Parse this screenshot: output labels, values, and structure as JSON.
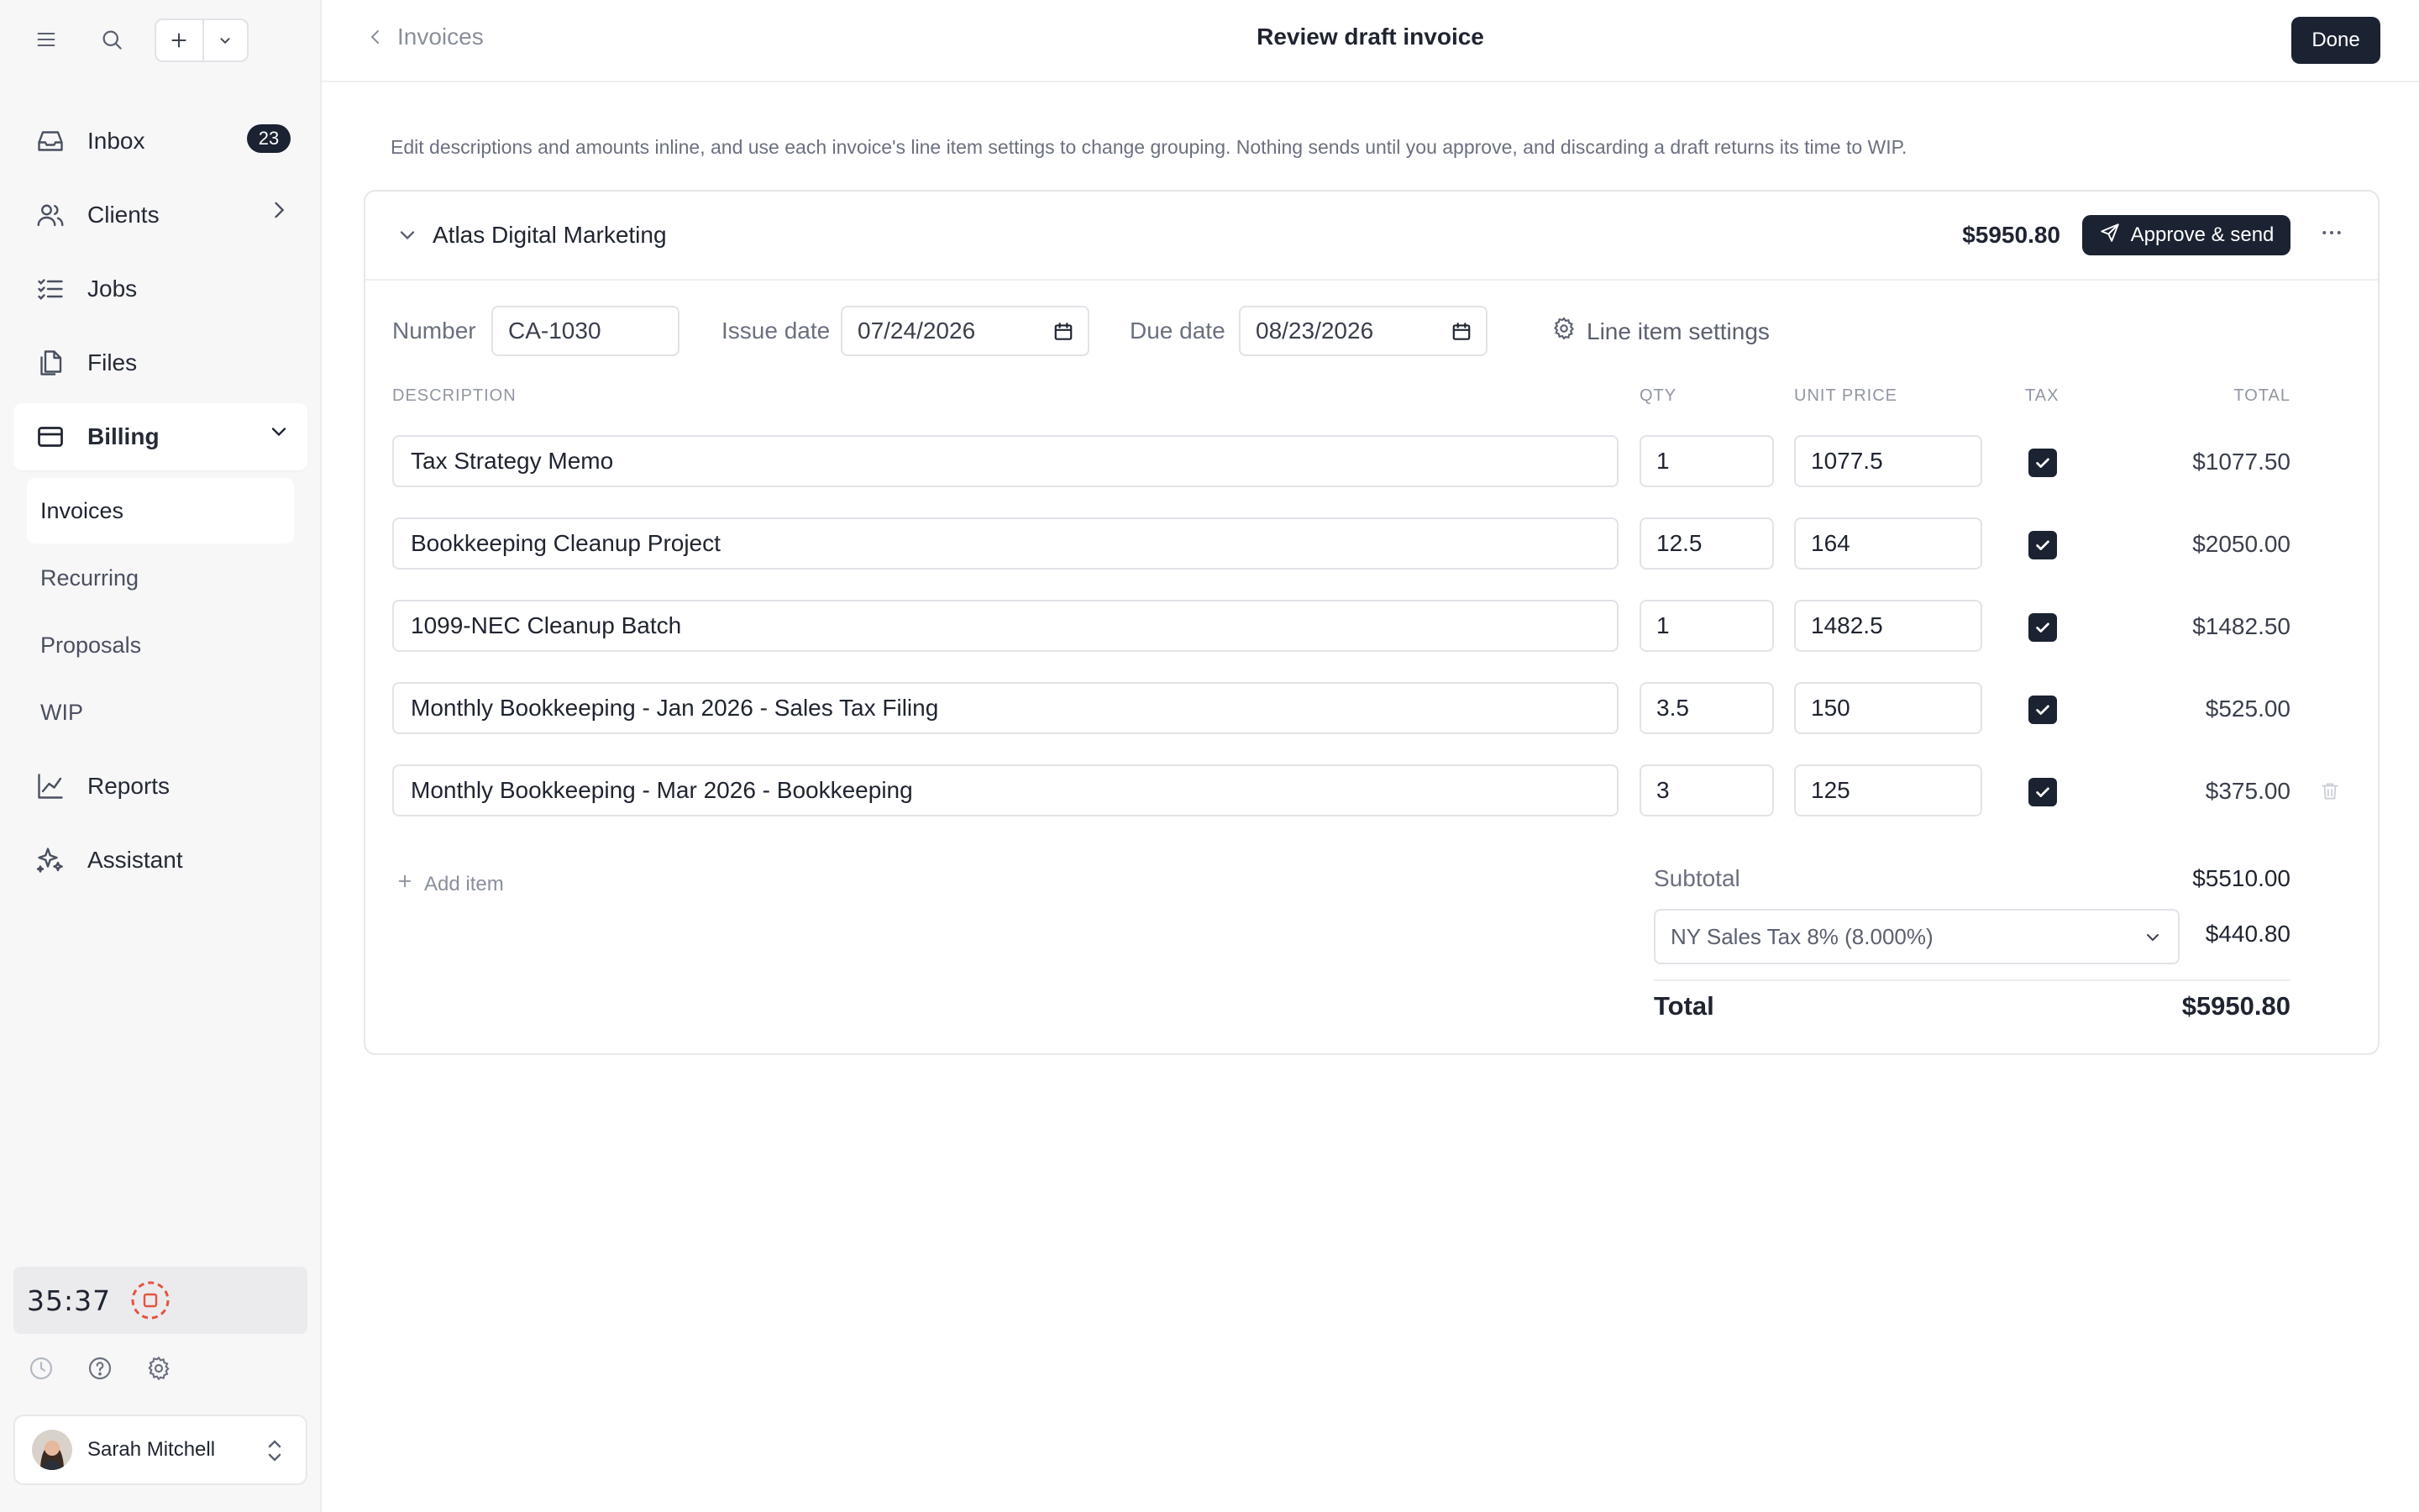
{
  "sidebar": {
    "nav": [
      {
        "label": "Inbox",
        "icon": "inbox-icon",
        "badge": "23"
      },
      {
        "label": "Clients",
        "icon": "users-icon"
      },
      {
        "label": "Jobs",
        "icon": "checklist-icon"
      },
      {
        "label": "Files",
        "icon": "files-icon"
      },
      {
        "label": "Billing",
        "icon": "credit-card-icon"
      },
      {
        "label": "Reports",
        "icon": "chart-line-icon"
      },
      {
        "label": "Assistant",
        "icon": "sparkles-icon"
      }
    ],
    "billing_sub": [
      "Invoices",
      "Recurring",
      "Proposals",
      "WIP"
    ],
    "timer": "35:37",
    "user": {
      "name": "Sarah Mitchell"
    }
  },
  "header": {
    "back_label": "Invoices",
    "title": "Review draft invoice",
    "done_label": "Done"
  },
  "intro": "Edit descriptions and amounts inline, and use each invoice's line item settings to change grouping. Nothing sends until you approve, and discarding a draft returns its time to WIP.",
  "invoice": {
    "client": "Atlas Digital Marketing",
    "total": "$5950.80",
    "approve_label": "Approve & send",
    "number_label": "Number",
    "number": "CA-1030",
    "issue_label": "Issue date",
    "issue_date": "07/24/2026",
    "due_label": "Due date",
    "due_date": "08/23/2026",
    "line_settings_label": "Line item settings",
    "columns": {
      "description": "DESCRIPTION",
      "qty": "QTY",
      "unit_price": "UNIT PRICE",
      "tax": "TAX",
      "total": "TOTAL"
    },
    "items": [
      {
        "description": "Tax Strategy Memo",
        "qty": "1",
        "unit_price": "1077.5",
        "tax": true,
        "total": "$1077.50"
      },
      {
        "description": "Bookkeeping Cleanup Project",
        "qty": "12.5",
        "unit_price": "164",
        "tax": true,
        "total": "$2050.00"
      },
      {
        "description": "1099-NEC Cleanup Batch",
        "qty": "1",
        "unit_price": "1482.5",
        "tax": true,
        "total": "$1482.50"
      },
      {
        "description": "Monthly Bookkeeping - Jan 2026 - Sales Tax Filing",
        "qty": "3.5",
        "unit_price": "150",
        "tax": true,
        "total": "$525.00"
      },
      {
        "description": "Monthly Bookkeeping - Mar 2026 - Bookkeeping",
        "qty": "3",
        "unit_price": "125",
        "tax": true,
        "total": "$375.00"
      }
    ],
    "add_item_label": "Add item",
    "subtotal_label": "Subtotal",
    "subtotal": "$5510.00",
    "tax_option": "NY Sales Tax 8% (8.000%)",
    "tax_amount": "$440.80",
    "grand_label": "Total",
    "grand_total": "$5950.80"
  },
  "colors": {
    "primary": "#1b2231",
    "sidebar_bg": "#f7f7f8",
    "timer_stop": "#e5533d"
  }
}
